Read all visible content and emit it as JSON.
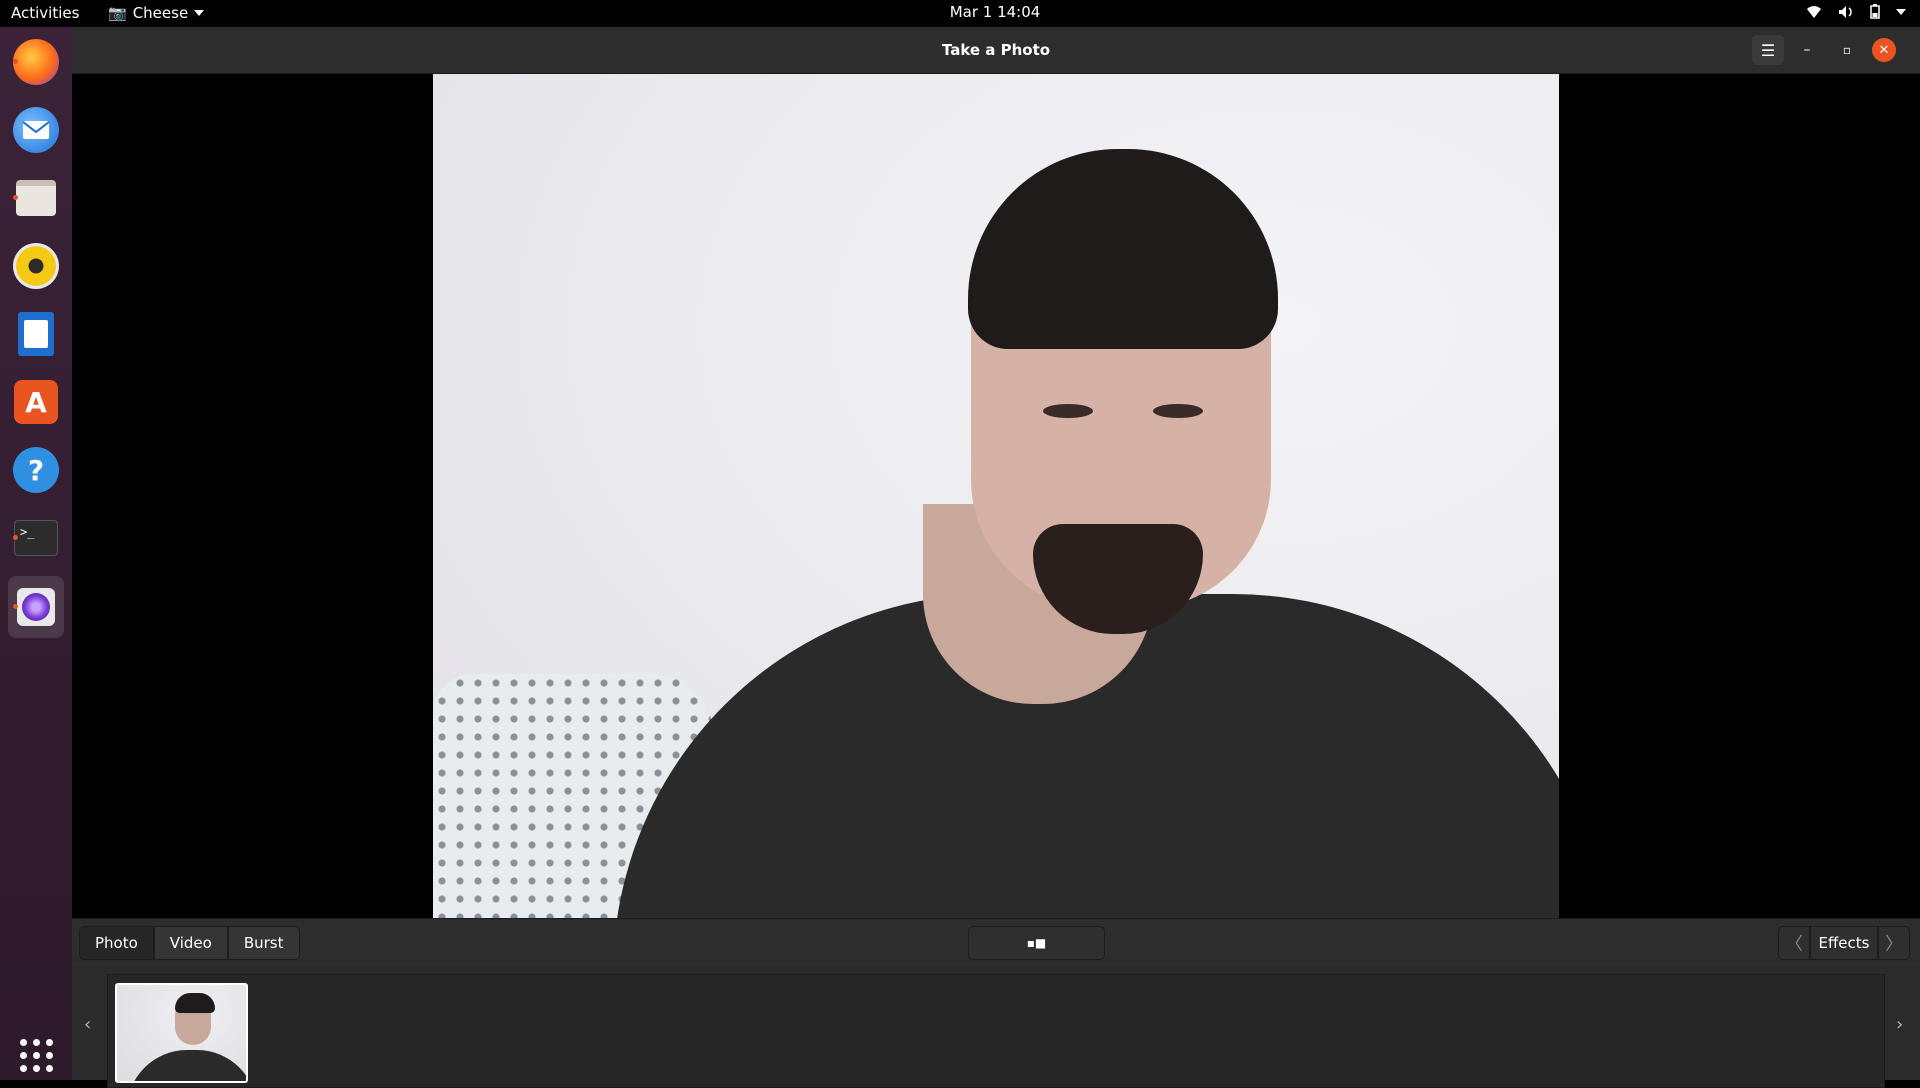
{
  "topbar": {
    "activities": "Activities",
    "app_name": "Cheese",
    "clock": "Mar 1  14:04",
    "tray_icons": [
      "wifi-icon",
      "volume-icon",
      "battery-icon",
      "system-menu-icon"
    ]
  },
  "dock": {
    "items": [
      {
        "name": "Firefox",
        "icon": "firefox-icon",
        "running": true
      },
      {
        "name": "Thunderbird",
        "icon": "thunderbird-icon",
        "running": false
      },
      {
        "name": "Files",
        "icon": "files-icon",
        "running": true
      },
      {
        "name": "Rhythmbox",
        "icon": "rhythmbox-icon",
        "running": false
      },
      {
        "name": "LibreOffice Writer",
        "icon": "writer-icon",
        "running": false
      },
      {
        "name": "Ubuntu Software",
        "icon": "software-icon",
        "running": false
      },
      {
        "name": "Help",
        "icon": "help-icon",
        "running": false
      },
      {
        "name": "Terminal",
        "icon": "terminal-icon",
        "running": true
      },
      {
        "name": "Cheese",
        "icon": "cheese-icon",
        "running": true,
        "active": true
      }
    ],
    "show_apps": "apps-grid-icon",
    "help_glyph": "?",
    "terminal_glyph": ">_"
  },
  "window": {
    "title": "Take a Photo",
    "menu_glyph": "☰",
    "minimize_glyph": "–",
    "maximize_glyph": "▫",
    "close_glyph": "✕"
  },
  "controls": {
    "modes": [
      "Photo",
      "Video",
      "Burst"
    ],
    "active_mode": "Photo",
    "shutter_icon": "camera-shutter-icon",
    "shutter_glyph": "▪■",
    "effects_label": "Effects",
    "prev_glyph": "〈",
    "next_glyph": "〉"
  },
  "thumbnails": {
    "count": 1,
    "left_arrow": "‹",
    "right_arrow": "›"
  },
  "colors": {
    "accent": "#e95420",
    "dock_bg": "#3b2238",
    "window_bg": "#2b2b2b"
  }
}
